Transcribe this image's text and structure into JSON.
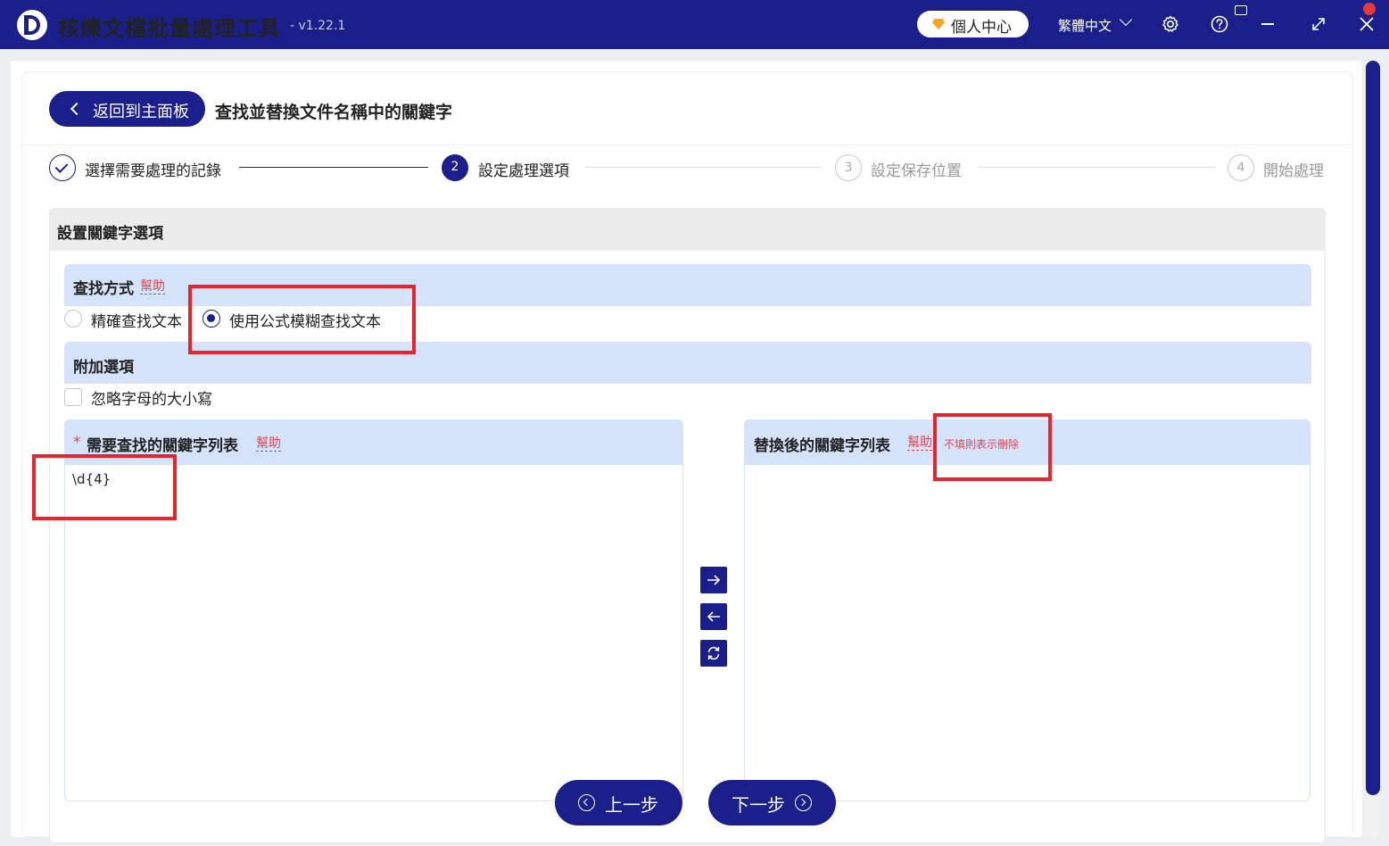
{
  "app": {
    "title": "核爍文檔批量處理工具",
    "version": "- v1.22.1",
    "vip_label": "個人中心",
    "language": "繁體中文",
    "accent_color": "#1b1f8c",
    "icons": [
      "gear-icon",
      "help-icon",
      "minimize-icon",
      "maximize-icon",
      "close-icon",
      "notification-icon"
    ]
  },
  "header": {
    "back_label": "返回到主面板",
    "page_title": "查找並替換文件名稱中的關鍵字"
  },
  "steps": [
    {
      "number": "1",
      "label": "選擇需要處理的記錄",
      "state": "done"
    },
    {
      "number": "2",
      "label": "設定處理選項",
      "state": "active"
    },
    {
      "number": "3",
      "label": "設定保存位置",
      "state": "pending"
    },
    {
      "number": "4",
      "label": "開始處理",
      "state": "pending"
    }
  ],
  "panel": {
    "title": "設置關鍵字選項",
    "search_mode": {
      "title": "查找方式",
      "help": "幫助",
      "options": [
        "精確查找文本",
        "使用公式模糊查找文本"
      ],
      "selected": "使用公式模糊查找文本"
    },
    "extra": {
      "title": "附加選項",
      "ignore_case_label": "忽略字母的大小寫",
      "ignore_case_checked": false
    },
    "find_list": {
      "required_mark": "*",
      "title": "需要查找的關鍵字列表",
      "help": "幫助",
      "value": "\\d{4}"
    },
    "replace_list": {
      "title": "替換後的關鍵字列表",
      "help": "幫助",
      "hint": "不填則表示刪除",
      "value": ""
    }
  },
  "nav": {
    "prev_label": "上一步",
    "next_label": "下一步"
  }
}
